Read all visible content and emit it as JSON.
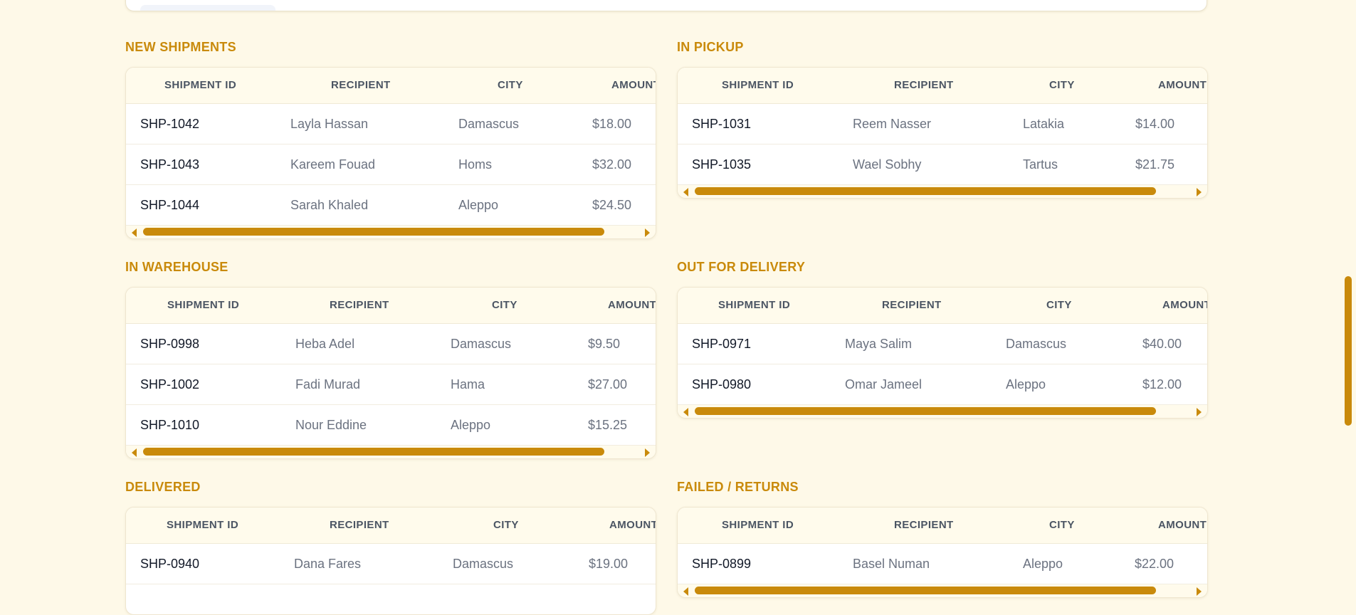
{
  "columns": {
    "shipment_id": "SHIPMENT ID",
    "recipient": "RECIPIENT",
    "city": "CITY",
    "amount": "AMOUNT"
  },
  "sections": {
    "new_shipments": {
      "title": "NEW SHIPMENTS",
      "rows": [
        {
          "id": "SHP-1042",
          "recipient": "Layla Hassan",
          "city": "Damascus",
          "amount": "$18.00"
        },
        {
          "id": "SHP-1043",
          "recipient": "Kareem Fouad",
          "city": "Homs",
          "amount": "$32.00"
        },
        {
          "id": "SHP-1044",
          "recipient": "Sarah Khaled",
          "city": "Aleppo",
          "amount": "$24.50"
        }
      ]
    },
    "in_pickup": {
      "title": "IN PICKUP",
      "rows": [
        {
          "id": "SHP-1031",
          "recipient": "Reem Nasser",
          "city": "Latakia",
          "amount": "$14.00"
        },
        {
          "id": "SHP-1035",
          "recipient": "Wael Sobhy",
          "city": "Tartus",
          "amount": "$21.75"
        }
      ]
    },
    "in_warehouse": {
      "title": "IN WAREHOUSE",
      "rows": [
        {
          "id": "SHP-0998",
          "recipient": "Heba Adel",
          "city": "Damascus",
          "amount": "$9.50"
        },
        {
          "id": "SHP-1002",
          "recipient": "Fadi Murad",
          "city": "Hama",
          "amount": "$27.00"
        },
        {
          "id": "SHP-1010",
          "recipient": "Nour Eddine",
          "city": "Aleppo",
          "amount": "$15.25"
        }
      ]
    },
    "out_for_delivery": {
      "title": "OUT FOR DELIVERY",
      "rows": [
        {
          "id": "SHP-0971",
          "recipient": "Maya Salim",
          "city": "Damascus",
          "amount": "$40.00"
        },
        {
          "id": "SHP-0980",
          "recipient": "Omar Jameel",
          "city": "Aleppo",
          "amount": "$12.00"
        }
      ]
    },
    "delivered": {
      "title": "DELIVERED",
      "rows": [
        {
          "id": "SHP-0940",
          "recipient": "Dana Fares",
          "city": "Damascus",
          "amount": "$19.00"
        }
      ]
    },
    "failed_returns": {
      "title": "FAILED / RETURNS",
      "rows": [
        {
          "id": "SHP-0899",
          "recipient": "Basel Numan",
          "city": "Aleppo",
          "amount": "$22.00"
        }
      ]
    }
  },
  "icons": {
    "scroll_left": "triangle-left-icon",
    "scroll_right": "triangle-right-icon"
  },
  "colors": {
    "accent": "#c98a0b",
    "background": "#fef9e8",
    "header_bg": "#fffbec"
  }
}
